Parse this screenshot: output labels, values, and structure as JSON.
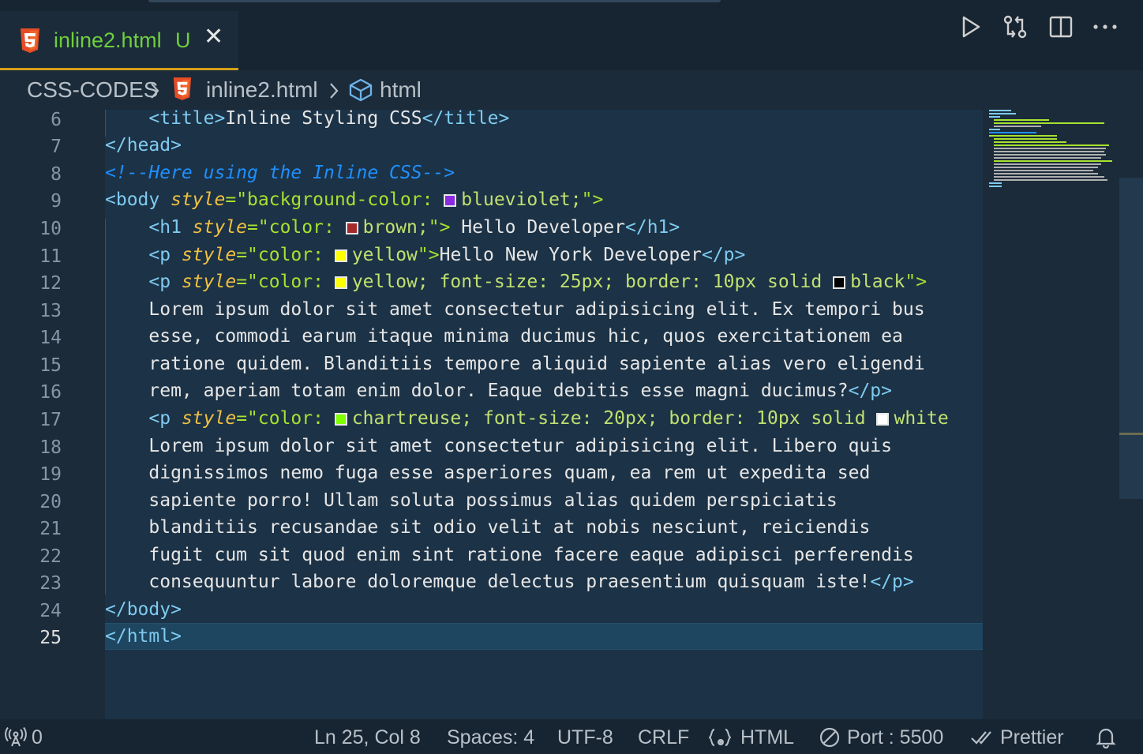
{
  "tab": {
    "filename": "inline2.html",
    "status": "U"
  },
  "breadcrumb": {
    "folder": "CSS-CODES",
    "file": "inline2.html",
    "symbol": "html"
  },
  "editor": {
    "line_numbers": [
      "6",
      "7",
      "8",
      "9",
      "10",
      "11",
      "12",
      "13",
      "14",
      "15",
      "16",
      "17",
      "18",
      "19",
      "20",
      "21",
      "22",
      "23",
      "24",
      "25"
    ],
    "current_line": "25",
    "lines": {
      "l6": {
        "pre": "    ",
        "open": "<title>",
        "text": "Inline Styling CSS",
        "close": "</title>"
      },
      "l7": {
        "tag": "</head>"
      },
      "l8": {
        "comment": "<!--Here using the Inline CSS-->"
      },
      "l9": {
        "open": "<body ",
        "attr": "style",
        "eq": "=\"background-color: ",
        "value": "blueviolet;",
        "end": "\">"
      },
      "l10": {
        "pre": "    ",
        "open": "<h1 ",
        "attr": "style",
        "eq": "=\"color: ",
        "value": "brown;",
        "end": "\"> ",
        "text": "Hello Developer",
        "close": "</h1>"
      },
      "l11": {
        "pre": "    ",
        "open": "<p ",
        "attr": "style",
        "eq": "=\"color: ",
        "value": "yellow",
        "end": "\">",
        "text": "Hello New York Developer",
        "close": "</p>"
      },
      "l12": {
        "pre": "    ",
        "open": "<p ",
        "attr": "style",
        "eq": "=\"color: ",
        "value": "yellow; font-size: 25px; border: 10px solid ",
        "value2": "black",
        "end": "\">"
      },
      "l13": {
        "text": "    Lorem ipsum dolor sit amet consectetur adipisicing elit. Ex tempori bus"
      },
      "l14": {
        "text": "    esse, commodi earum itaque minima ducimus hic, quos exercitationem ea"
      },
      "l15": {
        "text": "    ratione quidem. Blanditiis tempore aliquid sapiente alias vero eligendi"
      },
      "l16": {
        "text": "    rem, aperiam totam enim dolor. Eaque debitis esse magni ducimus?",
        "close": "</p>"
      },
      "l17": {
        "pre": "    ",
        "open": "<p ",
        "attr": "style",
        "eq": "=\"color: ",
        "value": "chartreuse; font-size: 20px; border: 10px solid ",
        "value2": "white"
      },
      "l18": {
        "text": "    Lorem ipsum dolor sit amet consectetur adipisicing elit. Libero quis"
      },
      "l19": {
        "text": "    dignissimos nemo fuga esse asperiores quam, ea rem ut expedita sed"
      },
      "l20": {
        "text": "    sapiente porro! Ullam soluta possimus alias quidem perspiciatis"
      },
      "l21": {
        "text": "    blanditiis recusandae sit odio velit at nobis nesciunt, reiciendis"
      },
      "l22": {
        "text": "    fugit cum sit quod enim sint ratione facere eaque adipisci perferendis"
      },
      "l23": {
        "text": "    consequuntur labore doloremque delectus praesentium quisquam iste!",
        "close": "</p>"
      },
      "l24": {
        "tag": "</body>"
      },
      "l25": {
        "tag": "</html>"
      }
    },
    "swatches": {
      "blueviolet": "#8a2be2",
      "brown": "#a52a2a",
      "yellow": "#ffff00",
      "black": "#000000",
      "chartreuse": "#7fff00",
      "white": "#ffffff"
    }
  },
  "statusbar": {
    "remote_count": "0",
    "cursor": "Ln 25, Col 8",
    "spaces": "Spaces: 4",
    "encoding": "UTF-8",
    "eol": "CRLF",
    "language": "HTML",
    "port": "Port : 5500",
    "formatter": "Prettier"
  },
  "colors": {
    "accent": "#d4a017",
    "tab_text": "#6fcf3c",
    "editor_bg": "#1c3246",
    "html5_icon": "#e44d26"
  },
  "icons": [
    "html5-icon",
    "close-icon",
    "run-icon",
    "compare-changes-icon",
    "split-editor-icon",
    "more-actions-icon",
    "chevron-right-icon",
    "symbol-cube-icon",
    "broadcast-icon",
    "braces-icon",
    "no-entry-icon",
    "double-check-icon",
    "bell-icon"
  ]
}
